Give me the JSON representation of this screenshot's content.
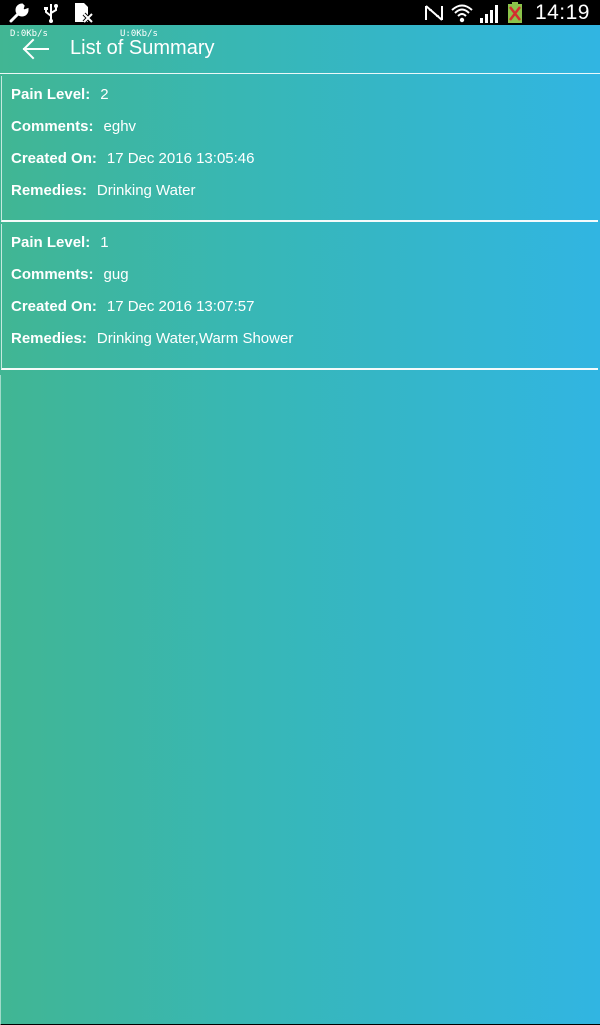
{
  "status_bar": {
    "time": "14:19",
    "left_icons": [
      "wrench-icon",
      "usb-icon",
      "sim-missing-icon"
    ],
    "right_icons": [
      "nfc-icon",
      "wifi-icon",
      "signal-icon",
      "battery-icon"
    ]
  },
  "network_speed": {
    "down": "D:0Kb/s",
    "up": "U:0Kb/s"
  },
  "toolbar": {
    "title": "List of Summary"
  },
  "entries": [
    {
      "pain_level_label": "Pain Level:",
      "pain_level": "2",
      "comments_label": "Comments:",
      "comments": "eghv",
      "created_on_label": "Created On:",
      "created_on": "17 Dec 2016 13:05:46",
      "remedies_label": "Remedies:",
      "remedies": "Drinking Water"
    },
    {
      "pain_level_label": "Pain Level:",
      "pain_level": "1",
      "comments_label": "Comments:",
      "comments": "gug",
      "created_on_label": "Created On:",
      "created_on": "17 Dec 2016 13:07:57",
      "remedies_label": "Remedies:",
      "remedies": "Drinking Water,Warm Shower"
    }
  ],
  "colors": {
    "gradient_start": "#41b693",
    "gradient_end": "#31b5e2",
    "text": "#ffffff"
  }
}
